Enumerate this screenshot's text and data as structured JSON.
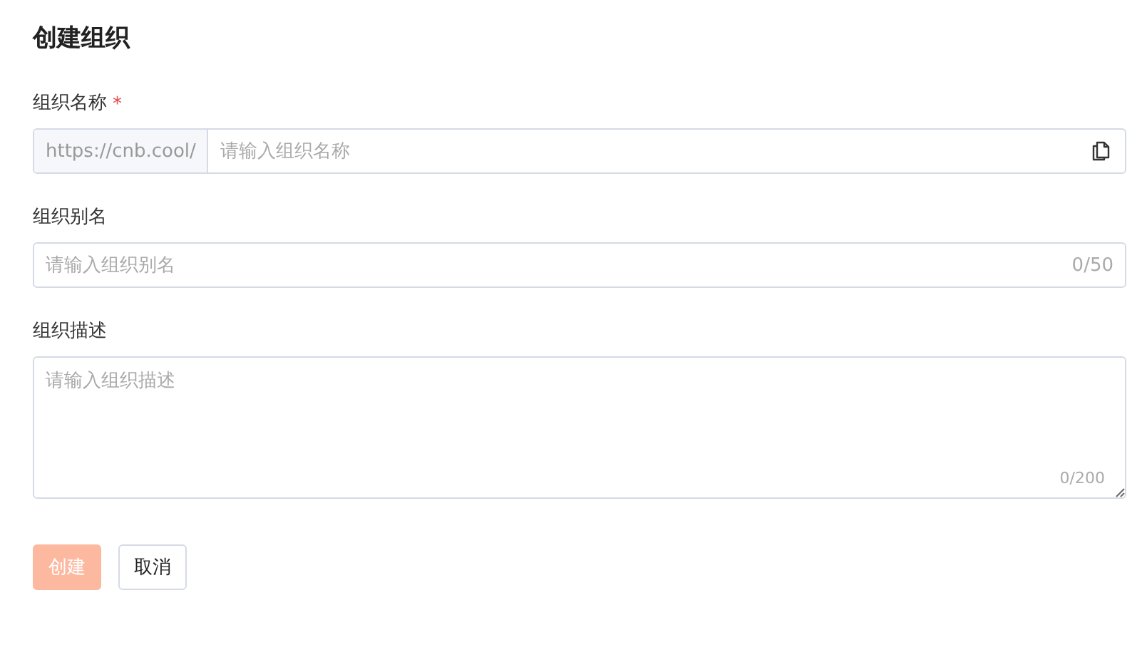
{
  "title": "创建组织",
  "fields": [
    {
      "kind": "prefixed",
      "label": "组织名称",
      "required": true,
      "prefix": "https://cnb.cool/",
      "placeholder": "请输入组织名称"
    },
    {
      "kind": "counter",
      "label": "组织别名",
      "required": false,
      "placeholder": "请输入组织别名",
      "counter": "0/50"
    },
    {
      "kind": "textarea",
      "label": "组织描述",
      "required": false,
      "placeholder": "请输入组织描述",
      "counter": "0/200"
    }
  ],
  "buttons": [
    {
      "label": "创建",
      "kind": "primary",
      "disabled": true
    },
    {
      "label": "取消",
      "kind": "default",
      "disabled": false
    }
  ],
  "required_mark": "*"
}
